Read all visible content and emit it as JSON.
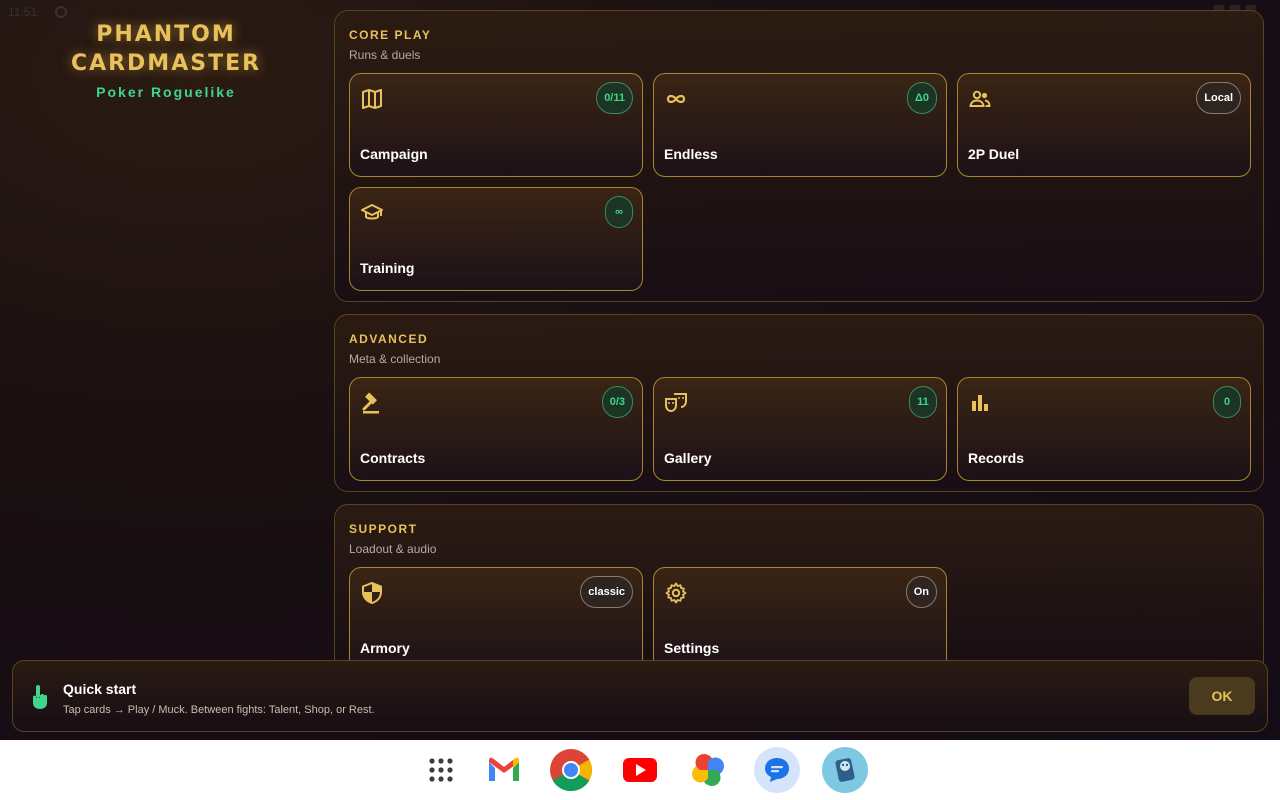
{
  "status_bar": {
    "time": "11:51"
  },
  "brand": {
    "title_line1": "PHANTOM",
    "title_line2": "CARDMASTER",
    "subtitle": "Poker Roguelike"
  },
  "sections": {
    "core": {
      "title": "CORE PLAY",
      "subtitle": "Runs & duels",
      "cards": [
        {
          "label": "Campaign",
          "badge": "0/11",
          "icon": "map-icon"
        },
        {
          "label": "Endless",
          "badge": "Δ0",
          "icon": "infinity-icon"
        },
        {
          "label": "2P Duel",
          "badge": "Local",
          "icon": "people-icon"
        },
        {
          "label": "Training",
          "badge": "∞",
          "icon": "graduation-cap-icon"
        }
      ]
    },
    "advanced": {
      "title": "ADVANCED",
      "subtitle": "Meta & collection",
      "cards": [
        {
          "label": "Contracts",
          "badge": "0/3",
          "icon": "gavel-icon"
        },
        {
          "label": "Gallery",
          "badge": "11",
          "icon": "theater-masks-icon"
        },
        {
          "label": "Records",
          "badge": "0",
          "icon": "bar-chart-icon"
        }
      ]
    },
    "support": {
      "title": "SUPPORT",
      "subtitle": "Loadout & audio",
      "cards": [
        {
          "label": "Armory",
          "badge": "classic",
          "icon": "shield-icon"
        },
        {
          "label": "Settings",
          "badge": "On",
          "icon": "gear-icon"
        }
      ]
    }
  },
  "quick_start": {
    "title": "Quick start",
    "text": "Tap cards → Play / Muck. Between fights: Talent, Shop, or Rest.",
    "ok_label": "OK"
  },
  "colors": {
    "accent_gold": "#e8c15a",
    "accent_green": "#3dd68c",
    "card_border": "#a8852e"
  }
}
